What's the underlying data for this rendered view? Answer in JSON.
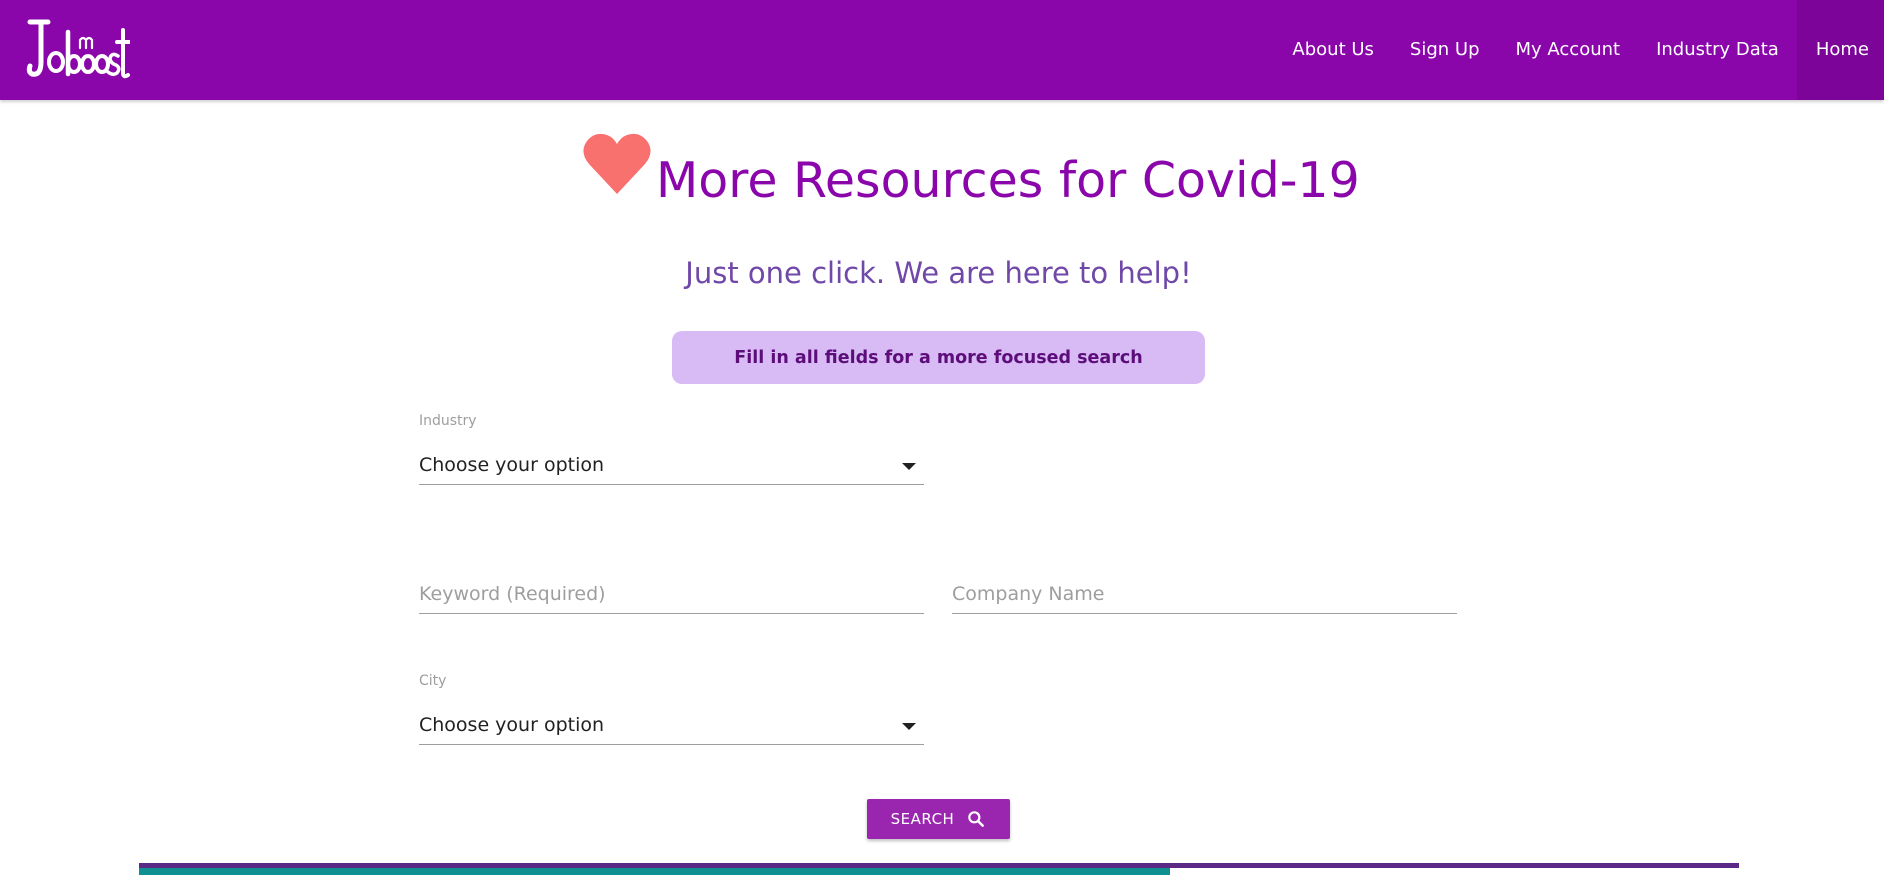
{
  "brand": {
    "logo_text": "Joboost",
    "logo_icon": "joboost-logo",
    "primary_color": "#8a06aa",
    "accent_color": "#9a26b0"
  },
  "nav": {
    "items": [
      {
        "label": "About Us"
      },
      {
        "label": "Sign Up"
      },
      {
        "label": "My Account"
      },
      {
        "label": "Industry Data"
      },
      {
        "label": "Home",
        "active": true
      }
    ]
  },
  "hero": {
    "icon": "heart-icon",
    "title": "More Resources for Covid-19",
    "subtitle": "Just one click. We are here to help!"
  },
  "notice": {
    "text": "Fill in all fields for a more focused search",
    "background": "#d8baf5"
  },
  "form": {
    "industry": {
      "label": "Industry",
      "value": "Choose your option"
    },
    "keyword": {
      "placeholder": "Keyword (Required)",
      "value": ""
    },
    "company": {
      "placeholder": "Company Name",
      "value": ""
    },
    "city": {
      "label": "City",
      "value": "Choose your option"
    },
    "search_button": {
      "label": "SEARCH",
      "icon": "search-icon"
    }
  }
}
